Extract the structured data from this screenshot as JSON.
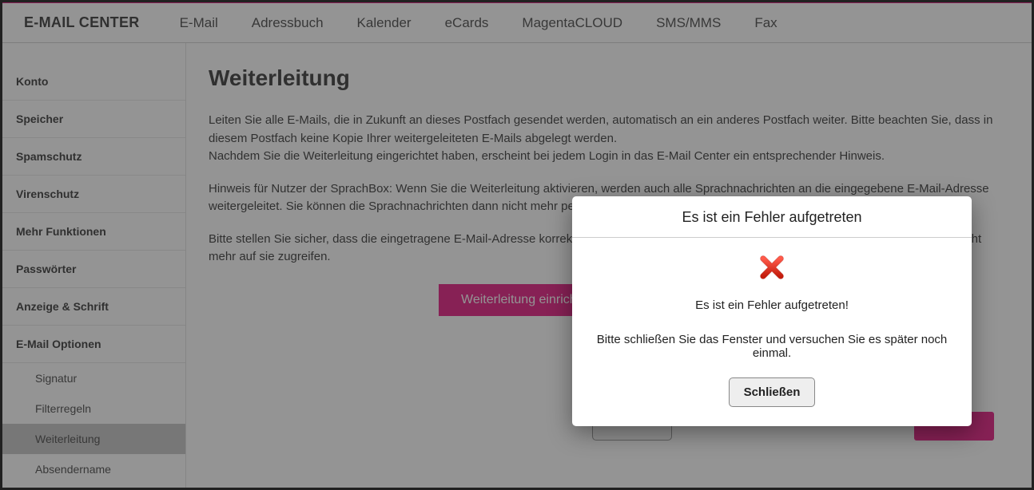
{
  "topnav": {
    "brand": "E-MAIL CENTER",
    "items": [
      "E-Mail",
      "Adressbuch",
      "Kalender",
      "eCards",
      "MagentaCLOUD",
      "SMS/MMS",
      "Fax"
    ]
  },
  "sidebar": {
    "items": [
      "Konto",
      "Speicher",
      "Spamschutz",
      "Virenschutz",
      "Mehr Funktionen",
      "Passwörter",
      "Anzeige & Schrift",
      "E-Mail Optionen"
    ],
    "subitems": [
      "Signatur",
      "Filterregeln",
      "Weiterleitung",
      "Absendername"
    ],
    "active_sub": "Weiterleitung"
  },
  "content": {
    "title": "Weiterleitung",
    "p1": "Leiten Sie alle E-Mails, die in Zukunft an dieses Postfach gesendet werden, automatisch an ein anderes Postfach weiter. Bitte beachten Sie, dass in diesem Postfach keine Kopie Ihrer weitergeleiteten E-Mails abgelegt werden.",
    "p2": "Nachdem Sie die Weiterleitung eingerichtet haben, erscheint bei jedem Login in das E-Mail Center ein entsprechender Hinweis.",
    "p3": "Hinweis für Nutzer der SprachBox: Wenn Sie die Weiterleitung aktivieren, werden auch alle Sprachnachrichten an die eingegebene E-Mail-Adresse weitergeleitet. Sie können die Sprachnachrichten dann nicht mehr per Telefon abfragen.",
    "p4": "Bitte stellen Sie sicher, dass die eingetragene E-Mail-Adresse korrekt ist. Ansonsten werden Ihre E-Mails nicht weitergeleitet und Sie können nicht mehr auf sie zugreifen.",
    "button": "Weiterleitung einrichten"
  },
  "modal": {
    "title": "Es ist ein Fehler aufgetreten",
    "msg1": "Es ist ein Fehler aufgetreten!",
    "msg2": "Bitte schließen Sie das Fenster und versuchen Sie es später noch einmal.",
    "close": "Schließen"
  }
}
